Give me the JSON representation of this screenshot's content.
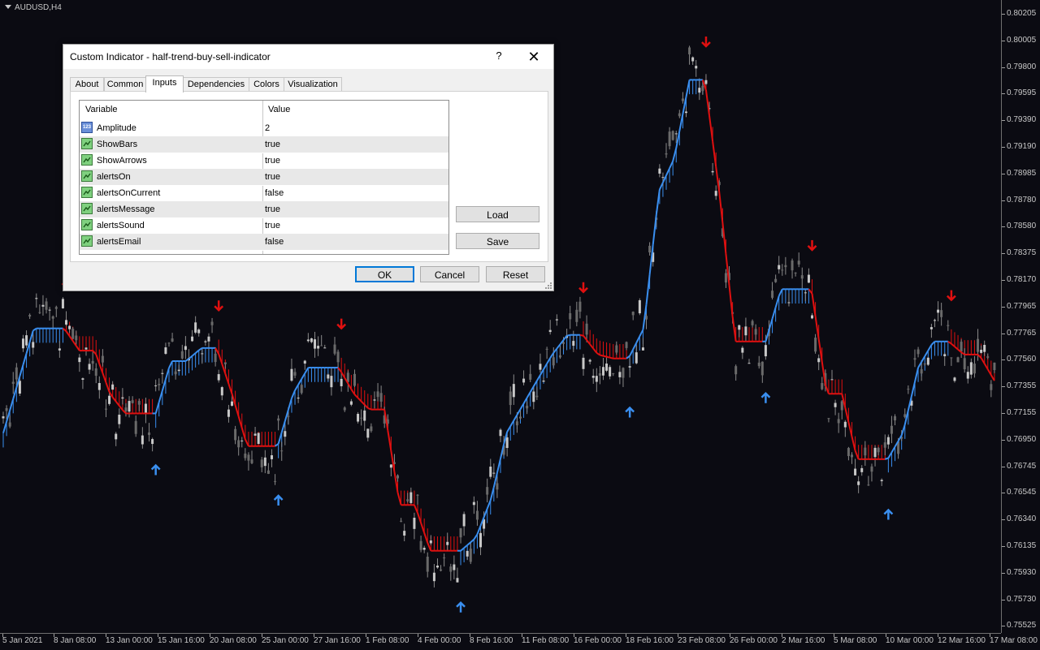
{
  "chart": {
    "symbol_label": "AUDUSD,H4",
    "price_levels": [
      "0.80205",
      "0.80005",
      "0.79800",
      "0.79595",
      "0.79390",
      "0.79190",
      "0.78985",
      "0.78780",
      "0.78580",
      "0.78375",
      "0.78170",
      "0.77965",
      "0.77765",
      "0.77560",
      "0.77355",
      "0.77155",
      "0.76950",
      "0.76745",
      "0.76545",
      "0.76340",
      "0.76135",
      "0.75930",
      "0.75730",
      "0.75525"
    ],
    "time_labels": [
      "5 Jan 2021",
      "8 Jan 08:00",
      "13 Jan 00:00",
      "15 Jan 16:00",
      "20 Jan 08:00",
      "25 Jan 00:00",
      "27 Jan 16:00",
      "1 Feb 08:00",
      "4 Feb 00:00",
      "8 Feb 16:00",
      "11 Feb 08:00",
      "16 Feb 00:00",
      "18 Feb 16:00",
      "23 Feb 08:00",
      "26 Feb 00:00",
      "2 Mar 16:00",
      "5 Mar 08:00",
      "10 Mar 00:00",
      "12 Mar 16:00",
      "17 Mar 08:00"
    ],
    "colors": {
      "background": "#0b0b12",
      "candle": "#8a8a8a",
      "up_trend": "#3a8ff0",
      "down_trend": "#e01010",
      "axis_text": "#c8c8c8"
    },
    "trend_segments": [
      {
        "dir": "up",
        "points": [
          [
            0.77,
            0.774,
            0.778,
            0.778
          ]
        ]
      },
      {
        "dir": "down",
        "points": [
          [
            0.778,
            0.7763,
            0.7763,
            0.773,
            0.7715,
            0.7715
          ]
        ]
      },
      {
        "dir": "up",
        "points": [
          [
            0.7715,
            0.7755,
            0.7755,
            0.7765
          ]
        ]
      },
      {
        "dir": "down",
        "points": [
          [
            0.7765,
            0.773,
            0.769,
            0.769
          ]
        ]
      },
      {
        "dir": "up",
        "points": [
          [
            0.769,
            0.773,
            0.775,
            0.775
          ]
        ]
      },
      {
        "dir": "down",
        "points": [
          [
            0.775,
            0.773,
            0.7718,
            0.7718,
            0.7645,
            0.7645,
            0.761,
            0.761
          ]
        ]
      },
      {
        "dir": "up",
        "points": [
          [
            0.761,
            0.762,
            0.765,
            0.77,
            0.772,
            0.774,
            0.776,
            0.7775
          ]
        ]
      },
      {
        "dir": "down",
        "points": [
          [
            0.7775,
            0.776,
            0.7757
          ]
        ]
      },
      {
        "dir": "up",
        "points": [
          [
            0.7757,
            0.778,
            0.7885,
            0.791,
            0.797
          ]
        ]
      },
      {
        "dir": "down",
        "points": [
          [
            0.797,
            0.788,
            0.777,
            0.777
          ]
        ]
      },
      {
        "dir": "up",
        "points": [
          [
            0.777,
            0.781,
            0.781
          ]
        ]
      },
      {
        "dir": "down",
        "points": [
          [
            0.781,
            0.773,
            0.773,
            0.768,
            0.768
          ]
        ]
      },
      {
        "dir": "up",
        "points": [
          [
            0.768,
            0.77,
            0.775,
            0.777
          ]
        ]
      },
      {
        "dir": "down",
        "points": [
          [
            0.777,
            0.776,
            0.776,
            0.774
          ]
        ]
      }
    ],
    "arrows": [
      {
        "dir": "down",
        "label": "sell"
      },
      {
        "dir": "up",
        "label": "buy"
      },
      {
        "dir": "down",
        "label": "sell"
      },
      {
        "dir": "up",
        "label": "buy"
      },
      {
        "dir": "down",
        "label": "sell"
      },
      {
        "dir": "up",
        "label": "buy"
      },
      {
        "dir": "down",
        "label": "sell"
      },
      {
        "dir": "up",
        "label": "buy"
      },
      {
        "dir": "down",
        "label": "sell"
      },
      {
        "dir": "up",
        "label": "buy"
      },
      {
        "dir": "down",
        "label": "sell"
      },
      {
        "dir": "up",
        "label": "buy"
      },
      {
        "dir": "down",
        "label": "sell"
      }
    ]
  },
  "dialog": {
    "title": "Custom Indicator - half-trend-buy-sell-indicator",
    "help_label": "?",
    "close_label": "✕",
    "tabs": [
      {
        "label": "About"
      },
      {
        "label": "Common"
      },
      {
        "label": "Inputs",
        "active": true
      },
      {
        "label": "Dependencies"
      },
      {
        "label": "Colors"
      },
      {
        "label": "Visualization"
      }
    ],
    "grid": {
      "header": {
        "variable": "Variable",
        "value": "Value"
      },
      "rows": [
        {
          "variable": "Amplitude",
          "value": "2",
          "type": "number"
        },
        {
          "variable": "ShowBars",
          "value": "true",
          "type": "bool"
        },
        {
          "variable": "ShowArrows",
          "value": "true",
          "type": "bool"
        },
        {
          "variable": "alertsOn",
          "value": "true",
          "type": "bool"
        },
        {
          "variable": "alertsOnCurrent",
          "value": "false",
          "type": "bool"
        },
        {
          "variable": "alertsMessage",
          "value": "true",
          "type": "bool"
        },
        {
          "variable": "alertsSound",
          "value": "true",
          "type": "bool"
        },
        {
          "variable": "alertsEmail",
          "value": "false",
          "type": "bool"
        }
      ],
      "number_icon_text": "123"
    },
    "buttons": {
      "load": "Load",
      "save": "Save",
      "ok": "OK",
      "cancel": "Cancel",
      "reset": "Reset"
    }
  }
}
